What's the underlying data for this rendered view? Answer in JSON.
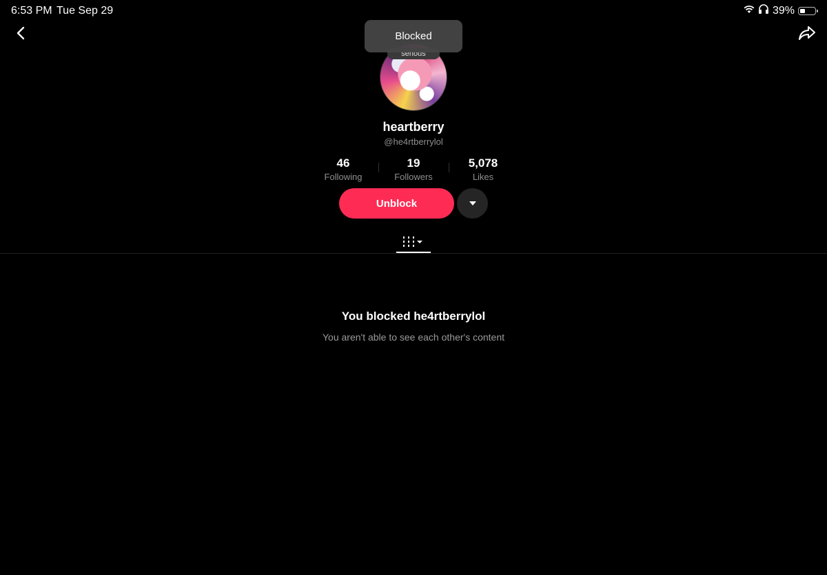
{
  "status_bar": {
    "time": "6:53 PM",
    "date": "Tue Sep 29",
    "battery_percent": "39%",
    "battery_level": 0.39,
    "icons": [
      "wifi-icon",
      "headphones-icon",
      "battery-icon"
    ]
  },
  "nav": {
    "back_icon": "chevron-left-icon",
    "share_icon": "share-arrow-icon"
  },
  "toast": {
    "text": "Blocked"
  },
  "profile": {
    "avatar_badge": "serious",
    "display_name": "heartberry",
    "username": "@he4rtberrylol",
    "stats": [
      {
        "value": "46",
        "label": "Following"
      },
      {
        "value": "19",
        "label": "Followers"
      },
      {
        "value": "5,078",
        "label": "Likes"
      }
    ]
  },
  "actions": {
    "unblock_label": "Unblock",
    "more_icon": "caret-down-icon"
  },
  "tabs": {
    "active_icon": "videos-grid-icon"
  },
  "blocked_message": {
    "title": "You blocked he4rtberrylol",
    "subtitle": "You aren't able to see each other's content"
  },
  "colors": {
    "background": "#000000",
    "accent": "#fe2c55",
    "secondary_text": "#8f8f8f"
  }
}
